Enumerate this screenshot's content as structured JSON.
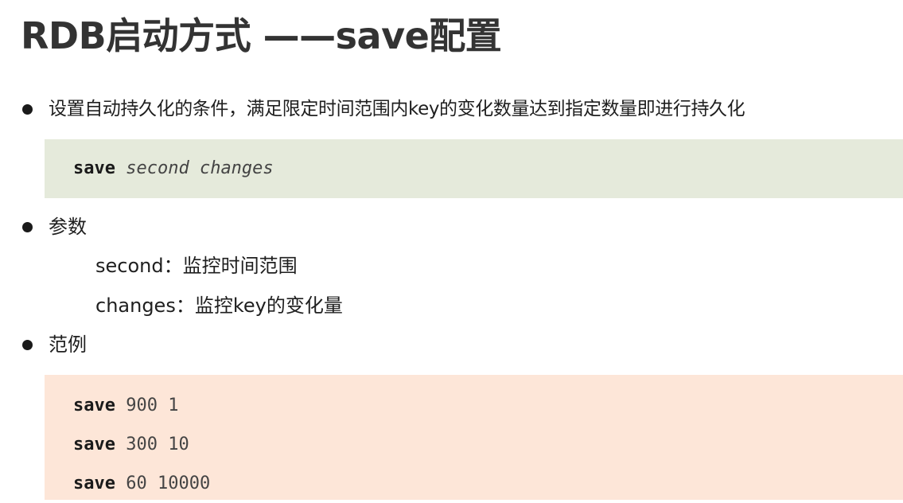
{
  "title": "RDB启动方式 ——save配置",
  "bullets": [
    {
      "text": "设置自动持久化的条件，满足限定时间范围内key的变化数量达到指定数量即进行持久化"
    },
    {
      "text": "参数"
    },
    {
      "text": "范例"
    }
  ],
  "syntax": {
    "keyword": "save",
    "args": "second changes"
  },
  "params": [
    {
      "text": "second：监控时间范围"
    },
    {
      "text": "changes：监控key的变化量"
    }
  ],
  "examples": [
    {
      "keyword": "save",
      "args": "900 1"
    },
    {
      "keyword": "save",
      "args": "300 10"
    },
    {
      "keyword": "save",
      "args": "60 10000"
    }
  ],
  "colors": {
    "syntax_box_bg": "#e5eadb",
    "example_box_bg": "#fde6d8",
    "title_text": "#333333"
  }
}
